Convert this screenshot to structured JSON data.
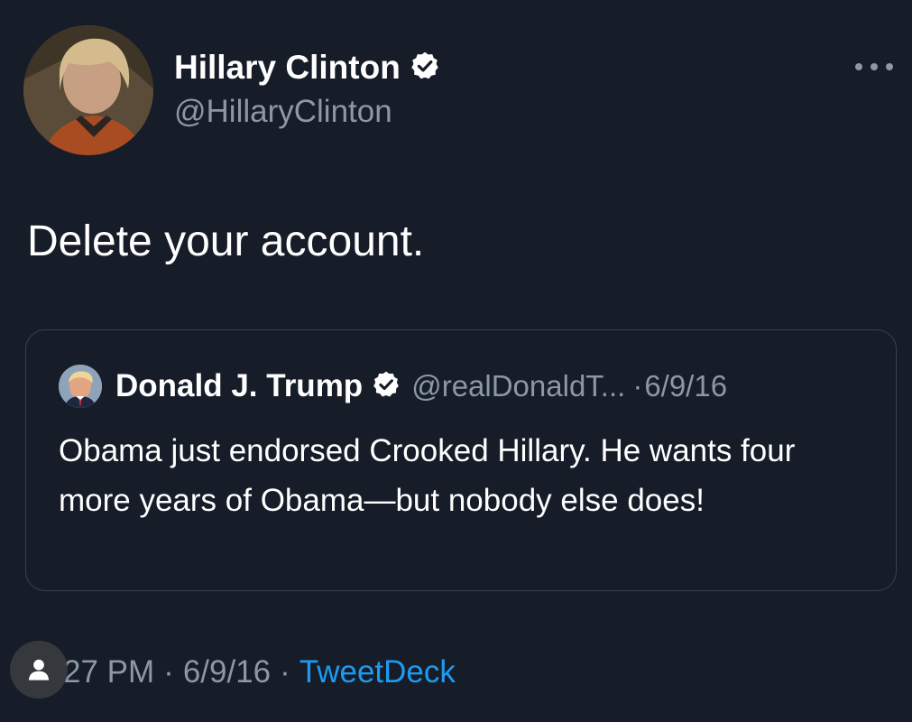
{
  "tweet": {
    "author": {
      "name": "Hillary Clinton",
      "handle": "@HillaryClinton",
      "verified": true
    },
    "text": "Delete your account.",
    "quoted": {
      "author": {
        "name": "Donald J. Trump",
        "handle": "@realDonaldT...",
        "verified": true
      },
      "separator": "·",
      "date": "6/9/16",
      "text": "Obama just endorsed Crooked Hillary. He wants four more years of Obama—but nobody else does!"
    },
    "meta": {
      "time": "27 PM",
      "dot": "·",
      "date": "6/9/16",
      "source": "TweetDeck"
    }
  },
  "colors": {
    "background": "#161c28",
    "text_primary": "#ffffff",
    "text_secondary": "#8b98a5",
    "link": "#1d9bf0",
    "border": "#38444d"
  },
  "icons": {
    "more": "more-horizontal-icon",
    "verified": "verified-badge-icon",
    "profile": "person-icon"
  }
}
